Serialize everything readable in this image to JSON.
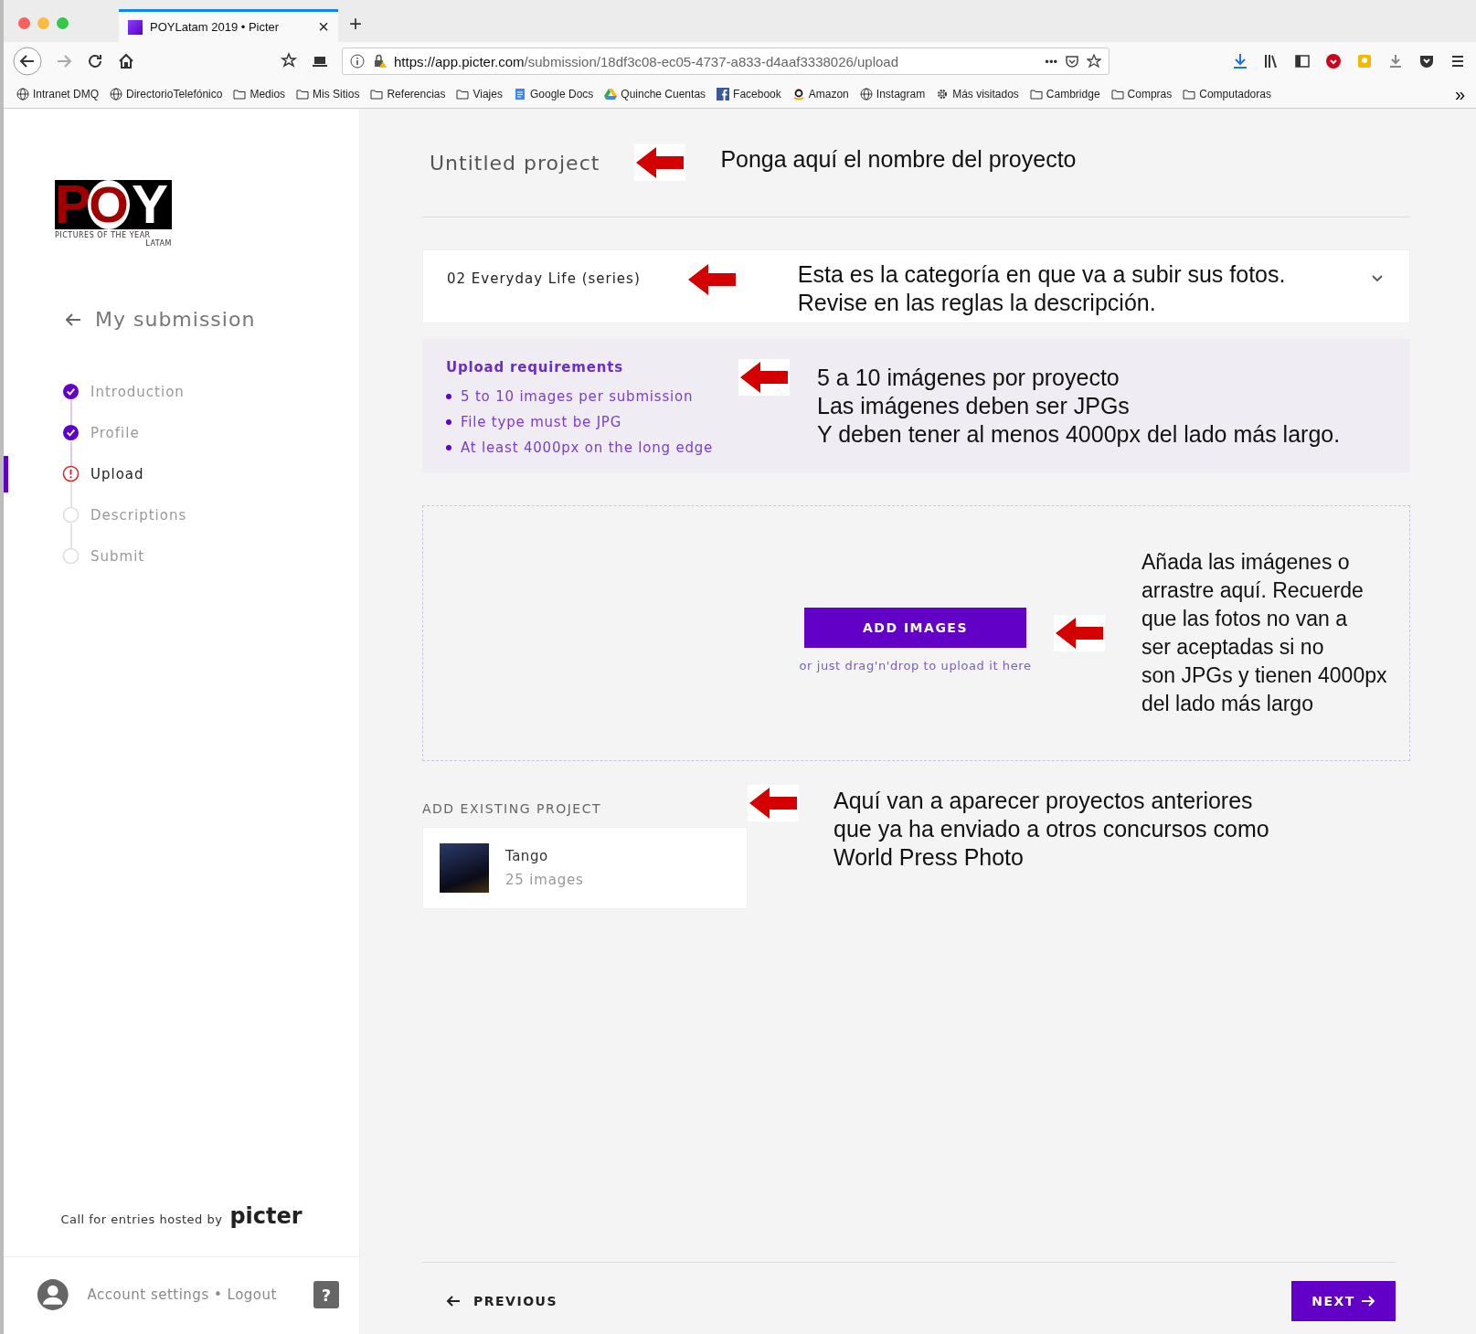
{
  "browser": {
    "tab_title": "POYLatam 2019 • Picter",
    "tab_close": "×",
    "new_tab": "+",
    "url_host": "https://app.picter.com",
    "url_path": "/submission/18df3c08-ec05-4737-a833-d4aaf3338026/upload",
    "url_more": "•••",
    "bookmarks": [
      {
        "kind": "globe",
        "label": "Intranet DMQ"
      },
      {
        "kind": "globe",
        "label": "DirectorioTelefónico"
      },
      {
        "kind": "folder",
        "label": "Medios"
      },
      {
        "kind": "folder",
        "label": "Mis Sitios"
      },
      {
        "kind": "folder",
        "label": "Referencias"
      },
      {
        "kind": "folder",
        "label": "Viajes"
      },
      {
        "kind": "docs",
        "label": "Google Docs"
      },
      {
        "kind": "drive",
        "label": "Quinche Cuentas"
      },
      {
        "kind": "facebook",
        "label": "Facebook"
      },
      {
        "kind": "amazon",
        "label": "Amazon"
      },
      {
        "kind": "globe",
        "label": "Instagram"
      },
      {
        "kind": "gear",
        "label": "Más visitados"
      },
      {
        "kind": "folder",
        "label": "Cambridge"
      },
      {
        "kind": "folder",
        "label": "Compras"
      },
      {
        "kind": "folder",
        "label": "Computadoras"
      }
    ],
    "overflow": "»"
  },
  "sidebar": {
    "logo": {
      "letters": [
        "P",
        "O",
        "Y"
      ],
      "tagline": "PICTURES OF THE YEAR",
      "region": "LATAM"
    },
    "back_label": "My submission",
    "steps": [
      {
        "label": "Introduction",
        "completed": true,
        "error": false,
        "selected": false
      },
      {
        "label": "Profile",
        "completed": true,
        "error": false,
        "selected": false
      },
      {
        "label": "Upload",
        "completed": false,
        "error": true,
        "selected": true
      },
      {
        "label": "Descriptions",
        "completed": false,
        "error": false,
        "selected": false
      },
      {
        "label": "Submit",
        "completed": false,
        "error": false,
        "selected": false
      }
    ],
    "hosted_by": "Call for entries hosted by",
    "brand": "picter",
    "account": "Account settings • Logout",
    "help": "?"
  },
  "main": {
    "project_title": "Untitled project",
    "category": "02 Everyday Life (series)",
    "requirements": {
      "title": "Upload requirements",
      "items": [
        "5 to 10 images per submission",
        "File type must be JPG",
        "At least 4000px on the long edge"
      ]
    },
    "add_button": "ADD IMAGES",
    "drop_hint": "or just drag'n'drop to upload it here",
    "existing": {
      "heading": "ADD EXISTING PROJECT",
      "projects": [
        {
          "name": "Tango",
          "count": "25 images"
        }
      ]
    },
    "previous": "PREVIOUS",
    "next": "NEXT"
  },
  "annotations": {
    "title": "Ponga aquí el nombre del proyecto",
    "category": "Esta es la categoría en que va a subir sus fotos.\nRevise en las reglas la descripción.",
    "requirements": "5 a 10 imágenes por proyecto\nLas imágenes deben ser JPGs\nY deben tener al menos 4000px del lado más largo.",
    "upload": "Añada las imágenes o\narrastre aquí. Recuerde\nque las fotos no van a\nser aceptadas si no\nson JPGs y tienen 4000px\ndel lado más largo",
    "existing": "Aquí van a aparecer proyectos anteriores\nque ya ha enviado a otros concursos como\nWorld Press Photo"
  }
}
